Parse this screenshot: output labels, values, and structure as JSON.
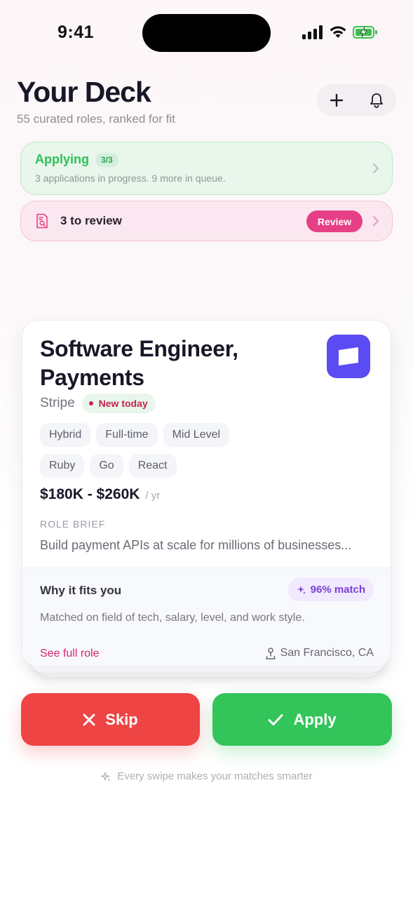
{
  "status_bar": {
    "time": "9:41"
  },
  "header": {
    "title": "Your Deck",
    "subtitle": "55 curated roles, ranked for fit",
    "actions": [
      {
        "icon": "plus-icon"
      },
      {
        "icon": "bell-icon"
      }
    ]
  },
  "applying": {
    "title": "Applying",
    "badge": "3/3",
    "description": "3 applications in progress. 9 more in queue.",
    "color": "#2fbf58"
  },
  "review": {
    "label": "3 to review",
    "button": "Review",
    "accent": "#e63f86"
  },
  "card": {
    "title": "Software Engineer, Payments",
    "company": "Stripe",
    "badge": "New today",
    "logo_color": "#5b4bf2",
    "tags_row1": [
      "Hybrid",
      "Full-time",
      "Mid Level"
    ],
    "tags_row2": [
      "Ruby",
      "Go",
      "React"
    ],
    "salary": "$180K - $260K",
    "salary_unit": "/ yr",
    "brief_label": "ROLE BRIEF",
    "brief_text": "Build payment APIs at scale for millions of businesses...",
    "fit_title": "Why it fits you",
    "match": "96% match",
    "fit_desc": "Matched on field of tech, salary, level, and work style.",
    "see_full": "See full role",
    "location": "San Francisco, CA"
  },
  "actions": {
    "skip": "Skip",
    "apply": "Apply",
    "skip_color": "#ef4444",
    "apply_color": "#33c45a"
  },
  "footer_hint": "Every swipe makes your matches smarter"
}
